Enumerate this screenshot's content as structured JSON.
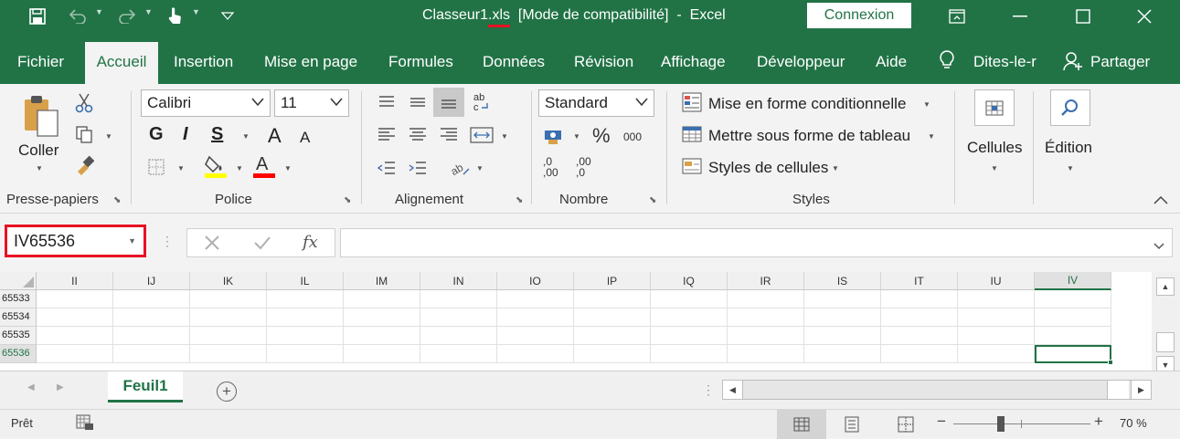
{
  "titlebar": {
    "filename": "Classeur1",
    "extension": ".xls",
    "mode": "[Mode de compatibilité]",
    "app": "Excel",
    "signin_label": "Connexion",
    "accent_color": "#217346"
  },
  "menu": {
    "tabs": [
      "Fichier",
      "Accueil",
      "Insertion",
      "Mise en page",
      "Formules",
      "Données",
      "Révision",
      "Affichage",
      "Développeur",
      "Aide"
    ],
    "tell_me": "Dites-le-r",
    "share": "Partager"
  },
  "ribbon": {
    "clipboard": {
      "paste_label": "Coller",
      "group_label": "Presse-papiers"
    },
    "font": {
      "font_name": "Calibri",
      "font_size": "11",
      "bold": "G",
      "italic": "I",
      "underline": "S",
      "grow": "A",
      "shrink": "A",
      "group_label": "Police",
      "fill_color": "#ffff00",
      "font_color": "#ff0000"
    },
    "alignment": {
      "group_label": "Alignement"
    },
    "number": {
      "format": "Standard",
      "percent": "%",
      "thousands": "000",
      "increase_decimal": ",0\n,00",
      "decrease_decimal": ",00\n,0",
      "group_label": "Nombre"
    },
    "styles": {
      "conditional": "Mise en forme conditionnelle",
      "table": "Mettre sous forme de tableau",
      "cell_styles": "Styles de cellules",
      "group_label": "Styles"
    },
    "cells": {
      "label": "Cellules"
    },
    "editing": {
      "label": "Édition"
    }
  },
  "formula_bar": {
    "name_box": "IV65536",
    "formula": "",
    "fx": "fx"
  },
  "grid": {
    "columns": [
      "II",
      "IJ",
      "IK",
      "IL",
      "IM",
      "IN",
      "IO",
      "IP",
      "IQ",
      "IR",
      "IS",
      "IT",
      "IU",
      "IV"
    ],
    "selected_column": "IV",
    "rows": [
      "65533",
      "65534",
      "65535",
      "65536"
    ],
    "selected_row": "65536"
  },
  "sheets": {
    "tabs": [
      "Feuil1"
    ],
    "add_label": "+"
  },
  "status": {
    "ready": "Prêt",
    "zoom": "70 %"
  }
}
